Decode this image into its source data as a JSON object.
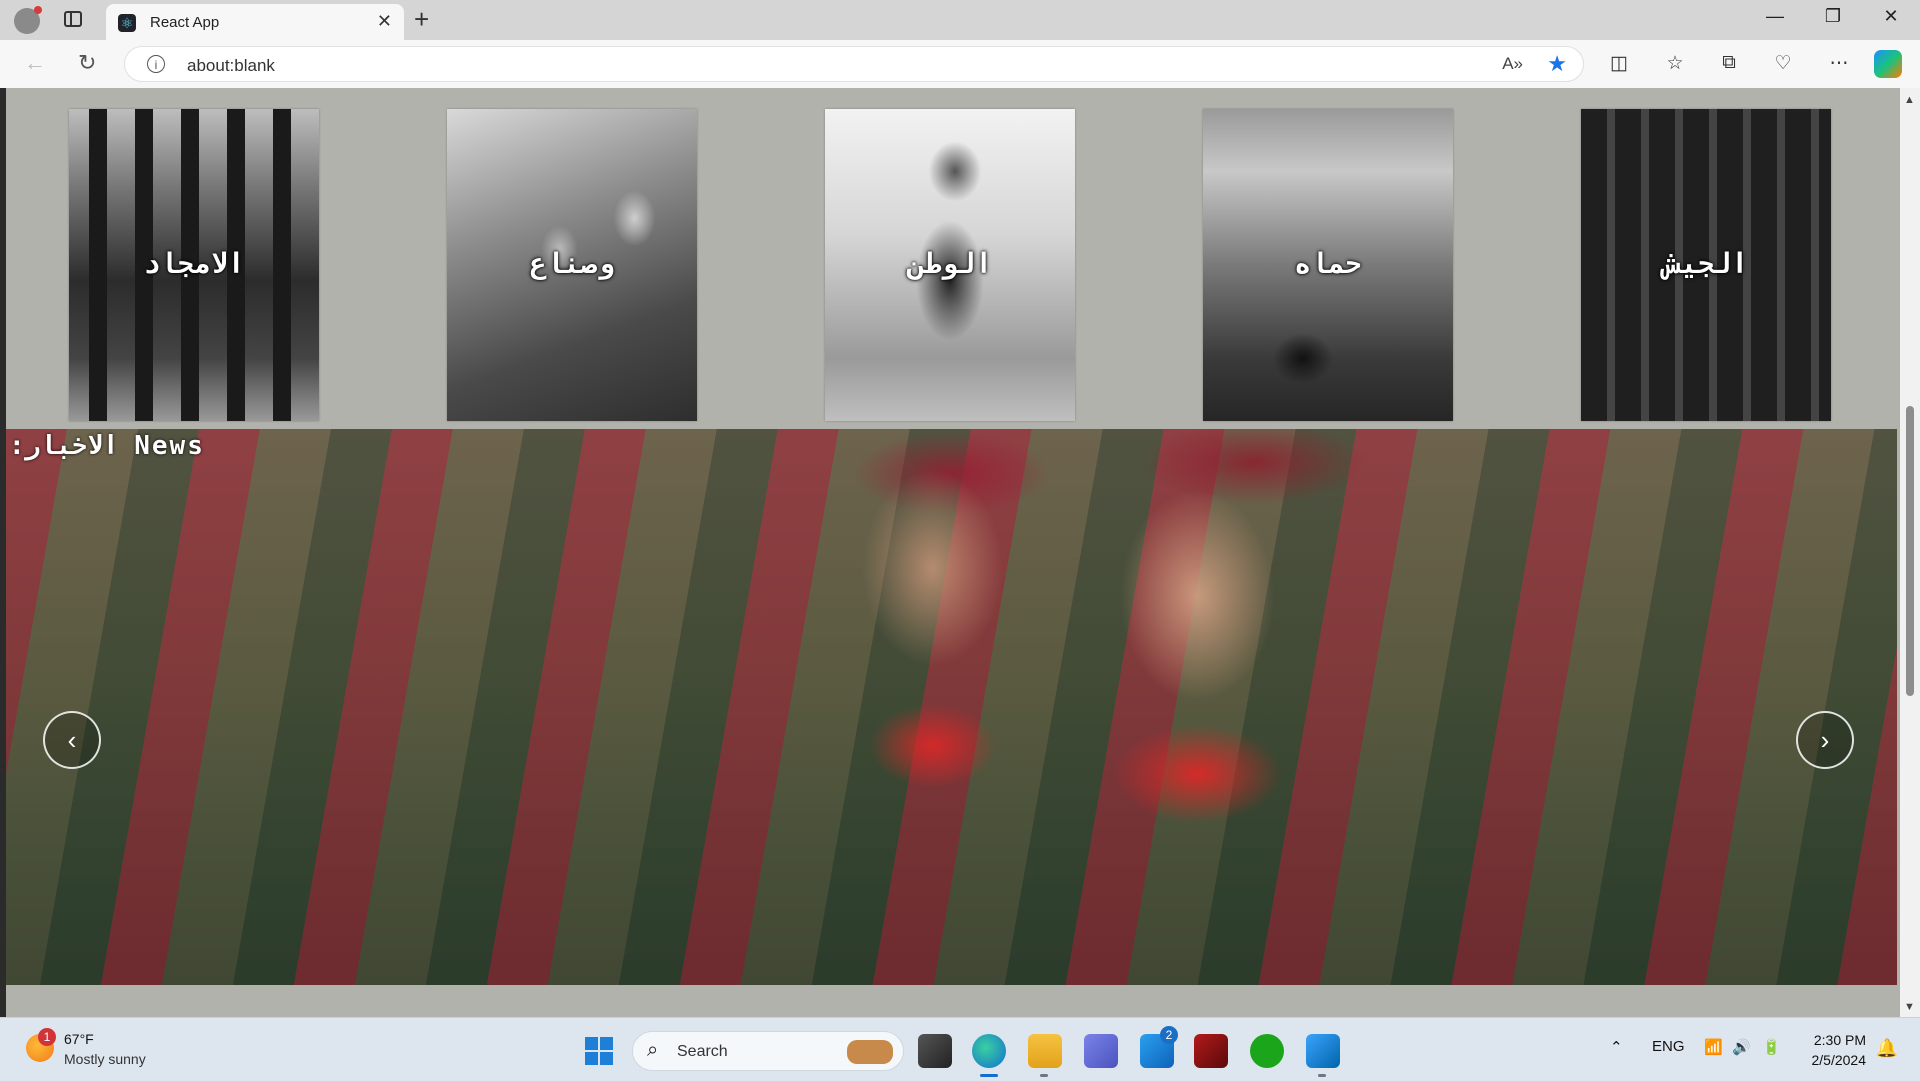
{
  "browser": {
    "tab_title": "React App",
    "tab_close": "✕",
    "new_tab": "+",
    "url": "about:blank",
    "window_controls": {
      "minimize": "—",
      "restore": "❐",
      "close": "✕"
    },
    "toolbar_icons": [
      "read-aloud-icon",
      "favorite-star-icon",
      "split-screen-icon",
      "favorites-icon",
      "collections-icon",
      "browser-essentials-icon",
      "more-icon",
      "copilot-icon"
    ]
  },
  "page": {
    "cards": [
      {
        "caption": "الامجاد"
      },
      {
        "caption": "وصناع"
      },
      {
        "caption": "الوطن"
      },
      {
        "caption": "حماه"
      },
      {
        "caption": "الجيش"
      }
    ],
    "news": {
      "label": ":الاخبار News",
      "prev": "‹",
      "next": "›"
    }
  },
  "taskbar": {
    "weather": {
      "temp": "67°F",
      "condition": "Mostly sunny",
      "badge": "1"
    },
    "search_placeholder": "Search",
    "mail_badge": "2",
    "language": "ENG",
    "time": "2:30 PM",
    "date": "2/5/2024",
    "apps": [
      "start-icon",
      "task-view-icon",
      "edge-icon",
      "file-explorer-icon",
      "teams-icon",
      "mail-icon",
      "app-icon",
      "xbox-icon",
      "vscode-icon"
    ]
  }
}
